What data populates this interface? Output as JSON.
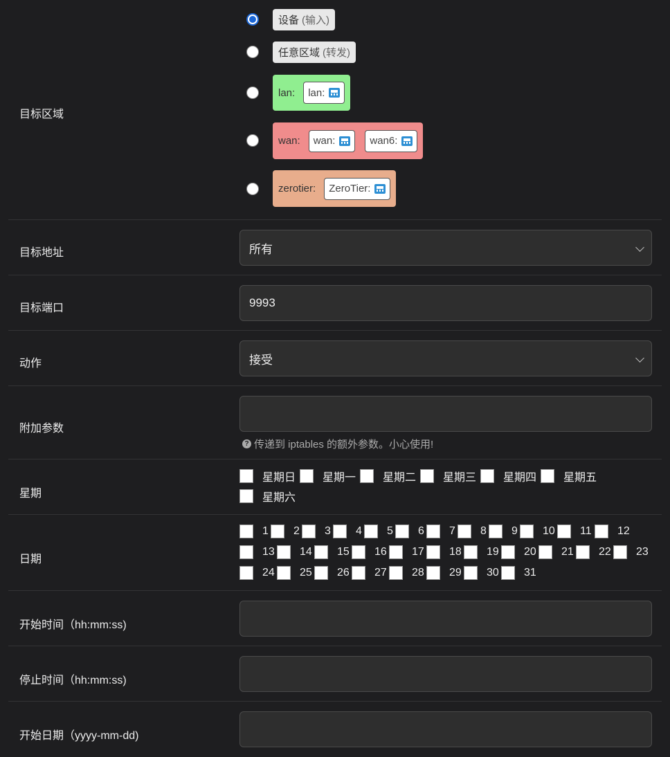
{
  "zones": {
    "label": "目标区域",
    "device": {
      "main": "设备",
      "sub": "(输入)",
      "checked": true
    },
    "any": {
      "main": "任意区域",
      "sub": "(转发)",
      "checked": false
    },
    "lan": {
      "name": "lan:",
      "ifaces": [
        "lan:"
      ],
      "color": "#90ee90"
    },
    "wan": {
      "name": "wan:",
      "ifaces": [
        "wan:",
        "wan6:"
      ],
      "color": "#f08c8c"
    },
    "zerotier": {
      "name": "zerotier:",
      "ifaces": [
        "ZeroTier:"
      ],
      "color": "#e8ad8c"
    },
    "iface_icon": "network-port-icon"
  },
  "dest_addr": {
    "label": "目标地址",
    "value": "所有"
  },
  "dest_port": {
    "label": "目标端口",
    "value": "9993"
  },
  "action": {
    "label": "动作",
    "value": "接受"
  },
  "extra": {
    "label": "附加参数",
    "value": "",
    "hint": "传递到 iptables 的额外参数。小心使用!"
  },
  "weekdays": {
    "label": "星期",
    "items": [
      "星期日",
      "星期一",
      "星期二",
      "星期三",
      "星期四",
      "星期五",
      "星期六"
    ]
  },
  "monthdays": {
    "label": "日期",
    "items": [
      "1",
      "2",
      "3",
      "4",
      "5",
      "6",
      "7",
      "8",
      "9",
      "10",
      "11",
      "12",
      "13",
      "14",
      "15",
      "16",
      "17",
      "18",
      "19",
      "20",
      "21",
      "22",
      "23",
      "24",
      "25",
      "26",
      "27",
      "28",
      "29",
      "30",
      "31"
    ]
  },
  "start_time": {
    "label": "开始时间（hh:mm:ss)",
    "value": ""
  },
  "stop_time": {
    "label": "停止时间（hh:mm:ss)",
    "value": ""
  },
  "start_date": {
    "label": "开始日期（yyyy-mm-dd)",
    "value": ""
  }
}
